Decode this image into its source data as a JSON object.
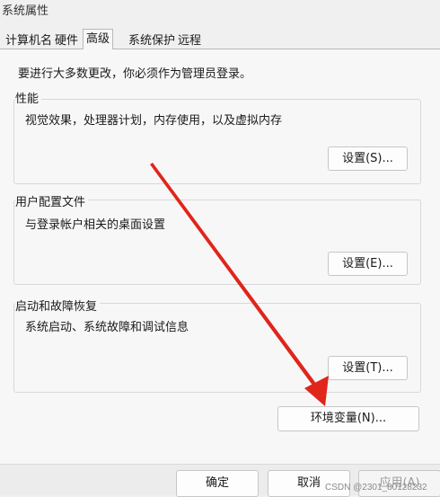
{
  "window": {
    "title": "系统属性"
  },
  "tabs": [
    {
      "label": "计算机名"
    },
    {
      "label": "硬件"
    },
    {
      "label": "高级",
      "active": true
    },
    {
      "label": "系统保护"
    },
    {
      "label": "远程"
    }
  ],
  "admin_note": "要进行大多数更改，你必须作为管理员登录。",
  "groups": {
    "performance": {
      "label": "性能",
      "desc": "视觉效果，处理器计划，内存使用，以及虚拟内存",
      "button": "设置(S)..."
    },
    "profiles": {
      "label": "用户配置文件",
      "desc": "与登录帐户相关的桌面设置",
      "button": "设置(E)..."
    },
    "startup": {
      "label": "启动和故障恢复",
      "desc": "系统启动、系统故障和调试信息",
      "button": "设置(T)..."
    }
  },
  "env_button": "环境变量(N)...",
  "footer": {
    "ok": "确定",
    "cancel": "取消",
    "apply": "应用(A)"
  },
  "watermark": "CSDN @2301_80128232",
  "colors": {
    "arrow": "#e0251b"
  }
}
